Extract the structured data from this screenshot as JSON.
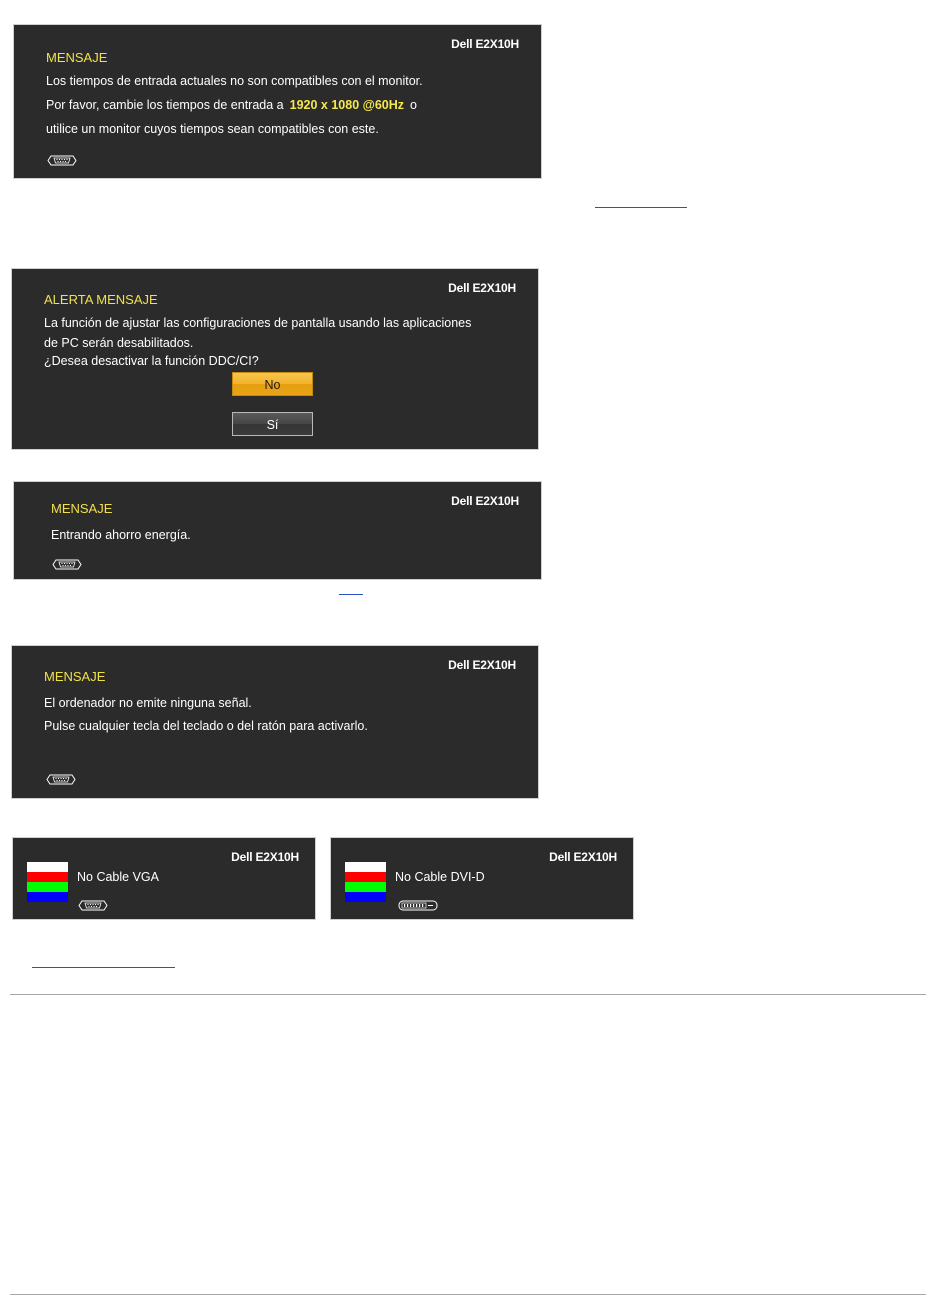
{
  "model": "Dell E2X10H",
  "box1": {
    "title": "MENSAJE",
    "line1": "Los tiempos de entrada actuales no son compatibles con el monitor.",
    "line2_pre": "Por favor, cambie los tiempos de entrada a",
    "line2_highlight": "1920 x 1080 @60Hz",
    "line2_post": "o",
    "line3": "utilice un monitor cuyos tiempos sean compatibles con este."
  },
  "box2": {
    "title": "ALERTA MENSAJE",
    "line1": "La función de ajustar las configuraciones de pantalla usando las aplicaciones",
    "line2": "de PC serán desabilitados.",
    "line3": "¿Desea desactivar la función DDC/CI?",
    "button_no": "No",
    "button_si": "Sí"
  },
  "box3": {
    "title": "MENSAJE",
    "line1": "Entrando ahorro energía."
  },
  "box4": {
    "title": "MENSAJE",
    "line1": "El ordenador no emite ninguna señal.",
    "line2": "Pulse cualquier tecla del teclado o del ratón para activarlo."
  },
  "box5": {
    "text": "No Cable VGA"
  },
  "box6": {
    "text": "No Cable DVI-D"
  },
  "colors": {
    "panel_bg": "#2b2b2b",
    "title_yellow": "#f0e14a",
    "bar_white": "#ffffff",
    "bar_red": "#ff0000",
    "bar_green": "#00ff00",
    "bar_blue": "#0000ff"
  }
}
